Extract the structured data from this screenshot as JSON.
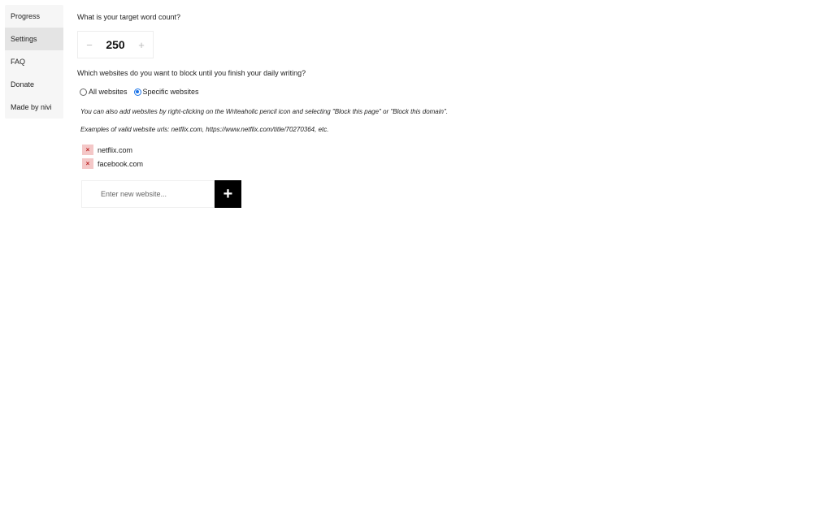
{
  "sidebar": {
    "items": [
      {
        "label": "Progress",
        "active": false
      },
      {
        "label": "Settings",
        "active": true
      },
      {
        "label": "FAQ",
        "active": false
      },
      {
        "label": "Donate",
        "active": false
      },
      {
        "label": "Made by nivi",
        "active": false
      }
    ]
  },
  "word_count": {
    "question": "What is your target word count?",
    "decrement_symbol": "−",
    "value": "250",
    "increment_symbol": "+"
  },
  "blocking": {
    "question": "Which websites do you want to block until you finish your daily writing?",
    "options": [
      {
        "label": "All websites",
        "checked": false
      },
      {
        "label": "Specific websites",
        "checked": true
      }
    ],
    "hint_right_click": "You can also add websites by right-clicking on the Writeaholic pencil icon and selecting \"Block this page\" or \"Block this domain\".",
    "hint_examples": "Examples of valid website urls: netflix.com, https://www.netflix.com/title/70270364, etc.",
    "remove_symbol": "×",
    "sites": [
      "netflix.com",
      "facebook.com"
    ],
    "input_placeholder": "Enter new website...",
    "add_symbol": "+"
  },
  "colors": {
    "accent": "#1a73e8",
    "remove_bg": "#f4c7c7",
    "add_button_bg": "#000000",
    "sidebar_bg": "#f6f6f6",
    "sidebar_active_bg": "#e4e4e4"
  }
}
